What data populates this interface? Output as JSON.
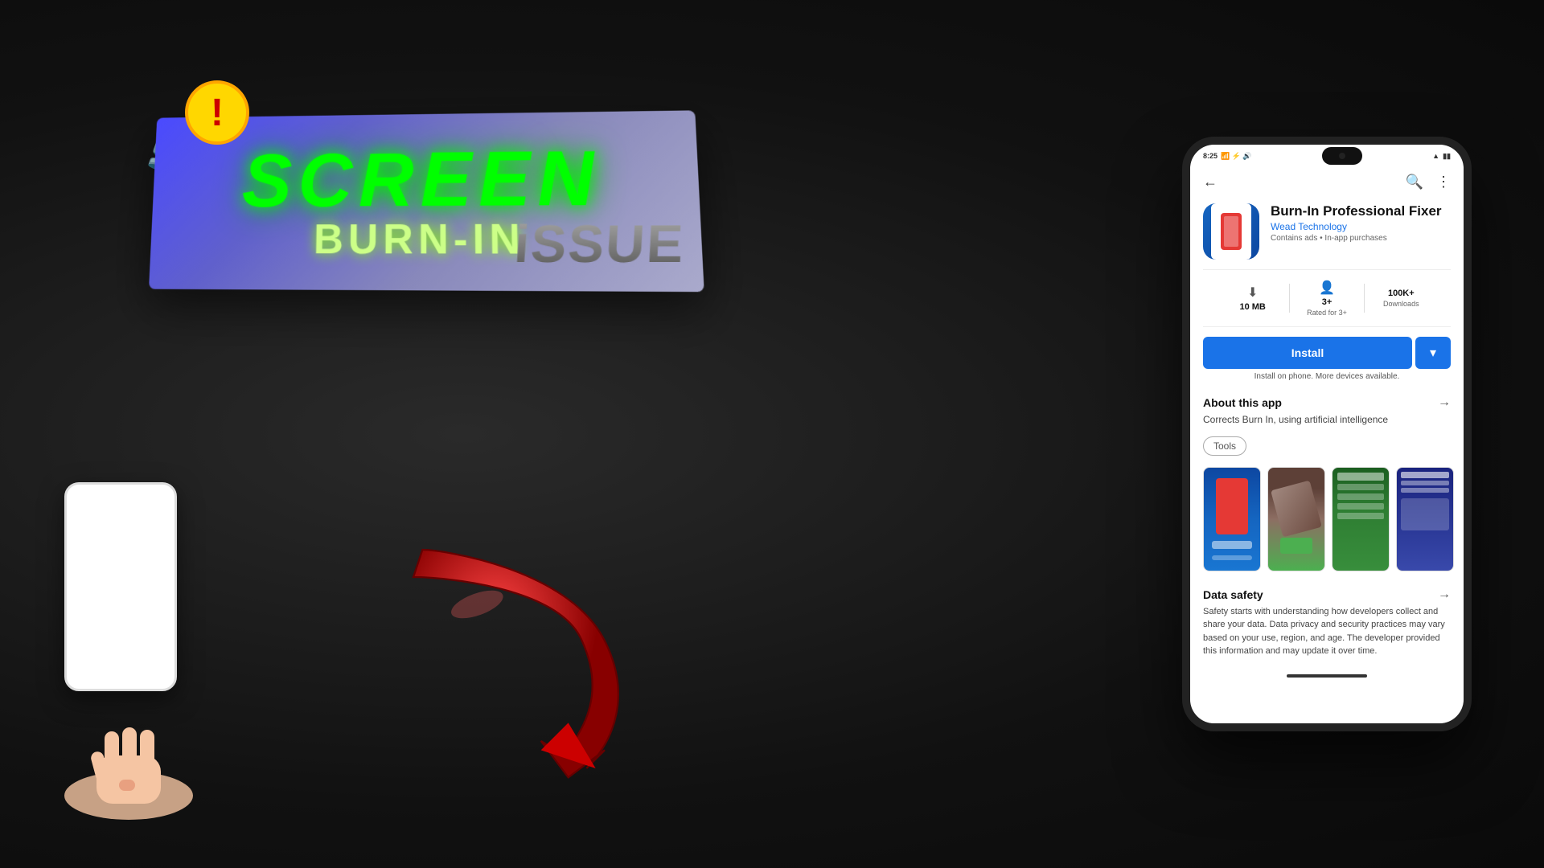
{
  "background": {
    "color": "#1a1a1a"
  },
  "banner": {
    "screen_text": "SCREEN",
    "burnin_text": "BURN-IN",
    "issue_text": "iSSUE"
  },
  "warning": {
    "symbol": "!"
  },
  "phone_mockup": {
    "status_bar": {
      "time": "8:25",
      "icons_left": "M ⊕ ◎ ▷",
      "wifi": "WiFi",
      "battery": "Battery"
    },
    "nav": {
      "back_label": "←",
      "search_label": "🔍",
      "menu_label": "⋮"
    },
    "app": {
      "name": "Burn-In Professional Fixer",
      "developer": "Wead Technology",
      "meta": "Contains ads • In-app purchases",
      "size": "10 MB",
      "size_label": "10 MB",
      "rating": "3+",
      "rating_label": "Rated for 3+",
      "downloads": "100K+",
      "downloads_label": "Downloads"
    },
    "install": {
      "button_label": "Install",
      "dropdown_label": "▾",
      "note": "Install on phone. More devices available."
    },
    "about": {
      "title": "About this app",
      "arrow": "→",
      "description": "Corrects Burn In, using artificial intelligence",
      "tag": "Tools"
    },
    "data_safety": {
      "title": "Data safety",
      "arrow": "→",
      "description": "Safety starts with understanding how developers collect and share your data. Data privacy and security practices may vary based on your use, region, and age. The developer provided this information and may update it over time."
    }
  }
}
